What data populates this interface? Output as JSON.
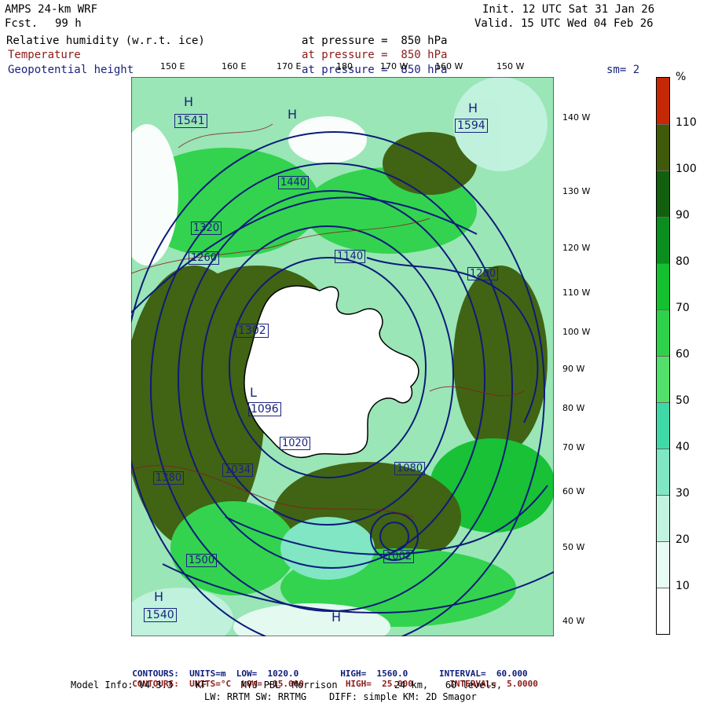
{
  "header": {
    "model": "AMPS 24-km WRF",
    "fcst_label": "Fcst.",
    "fcst_value": "99 h",
    "init": "Init. 12 UTC Sat 31 Jan 26",
    "valid": "Valid. 15 UTC Wed 04 Feb 26",
    "field1": "Relative humidity (w.r.t. ice)",
    "field1_level": "at pressure =  850 hPa",
    "field2": "Temperature",
    "field2_level": "at pressure =  850 hPa",
    "field3": "Geopotential height",
    "field3_level": "at pressure =  850 hPa",
    "smoothing": "sm= 2"
  },
  "longitude_labels_top": [
    "150 E",
    "160 E",
    "170 E",
    "180",
    "170 W",
    "160 W",
    "150 W"
  ],
  "longitude_labels_right": [
    "140 W",
    "130 W",
    "120 W",
    "110 W",
    "100 W",
    "90 W",
    "80 W",
    "70 W",
    "60 W",
    "50 W",
    "40 W"
  ],
  "height_labels": [
    "1541",
    "1540",
    "1500",
    "1440",
    "1380",
    "1320",
    "1260",
    "1200",
    "1140",
    "1080",
    "1020",
    "1096",
    "1594",
    "1034",
    "1302",
    "1002"
  ],
  "pressure_centers": [
    "H",
    "H",
    "H",
    "H",
    "L",
    "H"
  ],
  "colorbar": {
    "unit": "%",
    "levels": [
      "10",
      "20",
      "30",
      "40",
      "50",
      "60",
      "70",
      "80",
      "90",
      "100",
      "110"
    ],
    "colors": [
      "#ffffff",
      "#e8fbf4",
      "#c2f2e0",
      "#7fe7c4",
      "#3fd9a8",
      "#52e06a",
      "#2ed24a",
      "#12c030",
      "#0a8f1f",
      "#125f0e",
      "#3f5a08",
      "#c52805"
    ]
  },
  "footer": {
    "c1_label": "CONTOURS:",
    "c1_units": "UNITS=m",
    "c1_low": "LOW=  1020.0",
    "c1_high": "HIGH=  1560.0",
    "c1_interval": "INTERVAL=  60.000",
    "c2_label": "CONTOURS:",
    "c2_units": "UNITS=°C",
    "c2_low": "LOW= -15.000",
    "c2_high": "HIGH=  25.000",
    "c2_interval": "INTERVAL=  5.0000",
    "model_info": "Model Info: V4.3.3    KF      MYJ PBL  Morrison          24 km,   60 levels,",
    "model_info2": "LW: RRTM SW: RRTMG    DIFF: simple KM: 2D Smagor"
  }
}
